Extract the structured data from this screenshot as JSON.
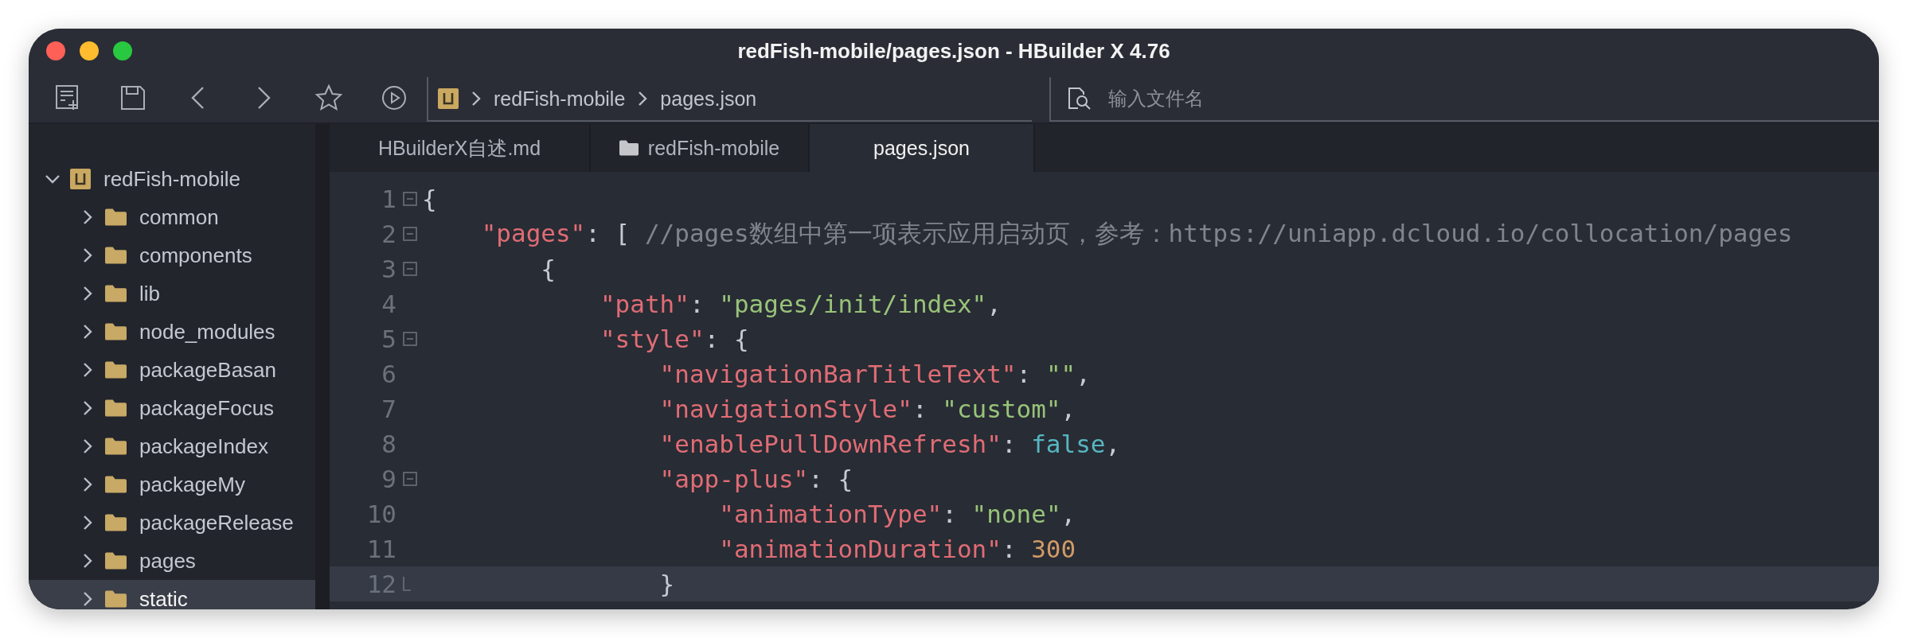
{
  "window": {
    "title": "redFish-mobile/pages.json - HBuilder X 4.76"
  },
  "toolbar": {
    "breadcrumb": [
      "redFish-mobile",
      "pages.json"
    ],
    "search": {
      "placeholder": "输入文件名"
    }
  },
  "sidebar": {
    "items": [
      {
        "label": "redFish-mobile",
        "kind": "project",
        "expanded": true,
        "selected": false,
        "children": [
          {
            "label": "common",
            "kind": "folder",
            "expanded": false,
            "selected": false
          },
          {
            "label": "components",
            "kind": "folder",
            "expanded": false,
            "selected": false
          },
          {
            "label": "lib",
            "kind": "folder",
            "expanded": false,
            "selected": false
          },
          {
            "label": "node_modules",
            "kind": "folder",
            "expanded": false,
            "selected": false
          },
          {
            "label": "packageBasan",
            "kind": "folder",
            "expanded": false,
            "selected": false
          },
          {
            "label": "packageFocus",
            "kind": "folder",
            "expanded": false,
            "selected": false
          },
          {
            "label": "packageIndex",
            "kind": "folder",
            "expanded": false,
            "selected": false
          },
          {
            "label": "packageMy",
            "kind": "folder",
            "expanded": false,
            "selected": false
          },
          {
            "label": "packageRelease",
            "kind": "folder",
            "expanded": false,
            "selected": false
          },
          {
            "label": "pages",
            "kind": "folder",
            "expanded": false,
            "selected": false
          },
          {
            "label": "static",
            "kind": "folder",
            "expanded": false,
            "selected": true
          }
        ]
      }
    ]
  },
  "tabs": [
    {
      "label": "HBuilderX自述.md",
      "kind": "file",
      "selected": false
    },
    {
      "label": "redFish-mobile",
      "kind": "folder",
      "selected": false
    },
    {
      "label": "pages.json",
      "kind": "file",
      "selected": true
    }
  ],
  "editor": {
    "lines": [
      {
        "number": "1",
        "kind": "fold_start",
        "current": false,
        "tokens": [
          {
            "kind": "punct",
            "text": "{"
          }
        ],
        "children": [
          {
            "number": "2",
            "kind": "fold_start",
            "current": false,
            "tokens": [
              {
                "kind": "key",
                "text": "\"pages\""
              },
              {
                "kind": "punct",
                "text": ": [ "
              },
              {
                "kind": "comment",
                "text": "//pages数组中第一项表示应用启动页，参考：https://uniapp.dcloud.io/collocation/pages"
              }
            ],
            "children": [
              {
                "number": "3",
                "kind": "fold_start",
                "current": false,
                "tokens": [
                  {
                    "kind": "punct",
                    "text": "{"
                  }
                ],
                "children": [
                  {
                    "number": "4",
                    "kind": "plain",
                    "current": false,
                    "tokens": [
                      {
                        "kind": "key",
                        "text": "\"path\""
                      },
                      {
                        "kind": "punct",
                        "text": ": "
                      },
                      {
                        "kind": "string",
                        "text": "\"pages/init/index\""
                      },
                      {
                        "kind": "punct",
                        "text": ","
                      }
                    ]
                  },
                  {
                    "number": "5",
                    "kind": "fold_start",
                    "current": false,
                    "tokens": [
                      {
                        "kind": "key",
                        "text": "\"style\""
                      },
                      {
                        "kind": "punct",
                        "text": ": {"
                      }
                    ],
                    "children": [
                      {
                        "number": "6",
                        "kind": "plain",
                        "current": false,
                        "tokens": [
                          {
                            "kind": "key",
                            "text": "\"navigationBarTitleText\""
                          },
                          {
                            "kind": "punct",
                            "text": ": "
                          },
                          {
                            "kind": "string",
                            "text": "\"\""
                          },
                          {
                            "kind": "punct",
                            "text": ","
                          }
                        ]
                      },
                      {
                        "number": "7",
                        "kind": "plain",
                        "current": false,
                        "tokens": [
                          {
                            "kind": "key",
                            "text": "\"navigationStyle\""
                          },
                          {
                            "kind": "punct",
                            "text": ": "
                          },
                          {
                            "kind": "string",
                            "text": "\"custom\""
                          },
                          {
                            "kind": "punct",
                            "text": ","
                          }
                        ]
                      },
                      {
                        "number": "8",
                        "kind": "plain",
                        "current": false,
                        "tokens": [
                          {
                            "kind": "key",
                            "text": "\"enablePullDownRefresh\""
                          },
                          {
                            "kind": "punct",
                            "text": ": "
                          },
                          {
                            "kind": "bool",
                            "text": "false"
                          },
                          {
                            "kind": "punct",
                            "text": ","
                          }
                        ]
                      },
                      {
                        "number": "9",
                        "kind": "fold_start",
                        "current": false,
                        "tokens": [
                          {
                            "kind": "key",
                            "text": "\"app-plus\""
                          },
                          {
                            "kind": "punct",
                            "text": ": {"
                          }
                        ],
                        "children": [
                          {
                            "number": "10",
                            "kind": "plain",
                            "current": false,
                            "tokens": [
                              {
                                "kind": "key",
                                "text": "\"animationType\""
                              },
                              {
                                "kind": "punct",
                                "text": ": "
                              },
                              {
                                "kind": "string",
                                "text": "\"none\""
                              },
                              {
                                "kind": "punct",
                                "text": ","
                              }
                            ]
                          },
                          {
                            "number": "11",
                            "kind": "plain",
                            "current": false,
                            "tokens": [
                              {
                                "kind": "key",
                                "text": "\"animationDuration\""
                              },
                              {
                                "kind": "punct",
                                "text": ": "
                              },
                              {
                                "kind": "number",
                                "text": "300"
                              }
                            ]
                          }
                        ]
                      },
                      {
                        "number": "12",
                        "kind": "fold_end",
                        "current": true,
                        "tokens": [
                          {
                            "kind": "punct",
                            "text": "}"
                          }
                        ]
                      }
                    ]
                  }
                ]
              }
            ]
          }
        ]
      }
    ]
  }
}
